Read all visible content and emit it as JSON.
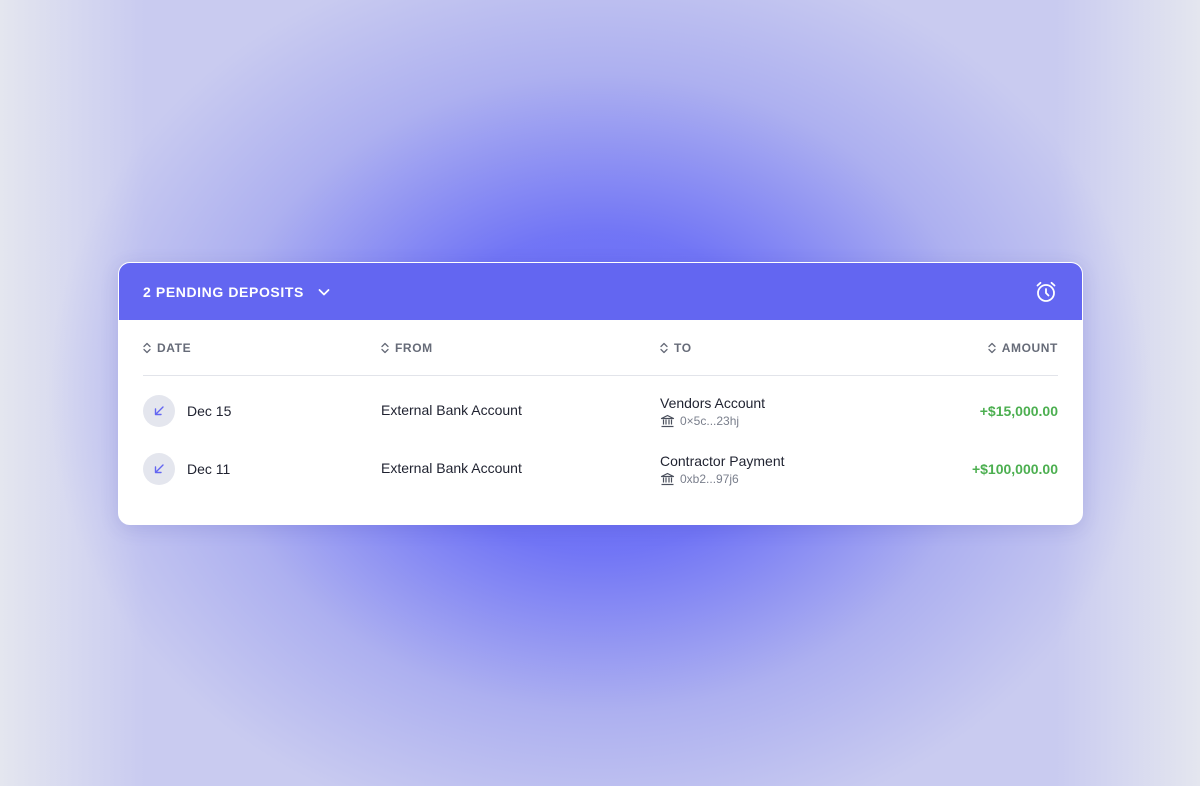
{
  "header": {
    "title": "2 PENDING DEPOSITS",
    "chevron_icon": "chevron-down-icon",
    "alarm_icon": "alarm-clock-icon"
  },
  "columns": {
    "date": "DATE",
    "from": "FROM",
    "to": "TO",
    "amount": "AMOUNT"
  },
  "rows": [
    {
      "date": "Dec 15",
      "from": "External Bank Account",
      "to_name": "Vendors Account",
      "to_address": "0×5c...23hj",
      "amount": "+$15,000.00"
    },
    {
      "date": "Dec 11",
      "from": "External Bank Account",
      "to_name": "Contractor Payment",
      "to_address": "0xb2...97j6",
      "amount": "+$100,000.00"
    }
  ],
  "colors": {
    "header_bg": "#6366f1",
    "amount_positive": "#4caf50",
    "badge_icon": "#6366f1"
  }
}
